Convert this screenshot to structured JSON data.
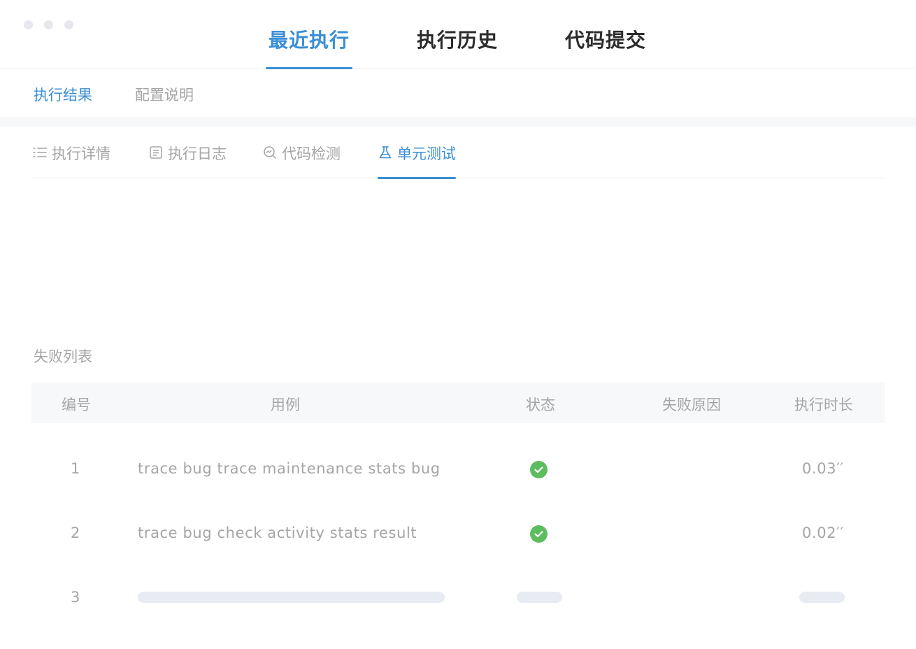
{
  "top_tabs": [
    {
      "label": "最近执行",
      "active": true
    },
    {
      "label": "执行历史",
      "active": false
    },
    {
      "label": "代码提交",
      "active": false
    }
  ],
  "sub_tabs": [
    {
      "label": "执行结果",
      "active": true
    },
    {
      "label": "配置说明",
      "active": false
    }
  ],
  "detail_tabs": [
    {
      "label": "执行详情",
      "icon": "list-icon",
      "active": false
    },
    {
      "label": "执行日志",
      "icon": "log-icon",
      "active": false
    },
    {
      "label": "代码检测",
      "icon": "code-scan-icon",
      "active": false
    },
    {
      "label": "单元测试",
      "icon": "flask-icon",
      "active": true
    }
  ],
  "failure_list": {
    "title": "失败列表",
    "columns": [
      "编号",
      "用例",
      "状态",
      "失败原因",
      "执行时长"
    ],
    "rows": [
      {
        "id": "1",
        "case": "trace bug trace maintenance stats bug",
        "status": "success",
        "reason": "",
        "duration": "0.03′′"
      },
      {
        "id": "2",
        "case": "trace bug check activity stats result",
        "status": "success",
        "reason": "",
        "duration": "0.02′′"
      },
      {
        "id": "3",
        "case": "",
        "status": "loading",
        "reason": "",
        "duration": ""
      }
    ]
  },
  "colors": {
    "accent": "#3b8ed6",
    "success": "#5cbd5f",
    "muted_text": "#a5a5a5",
    "skeleton": "#e8ebf2"
  }
}
